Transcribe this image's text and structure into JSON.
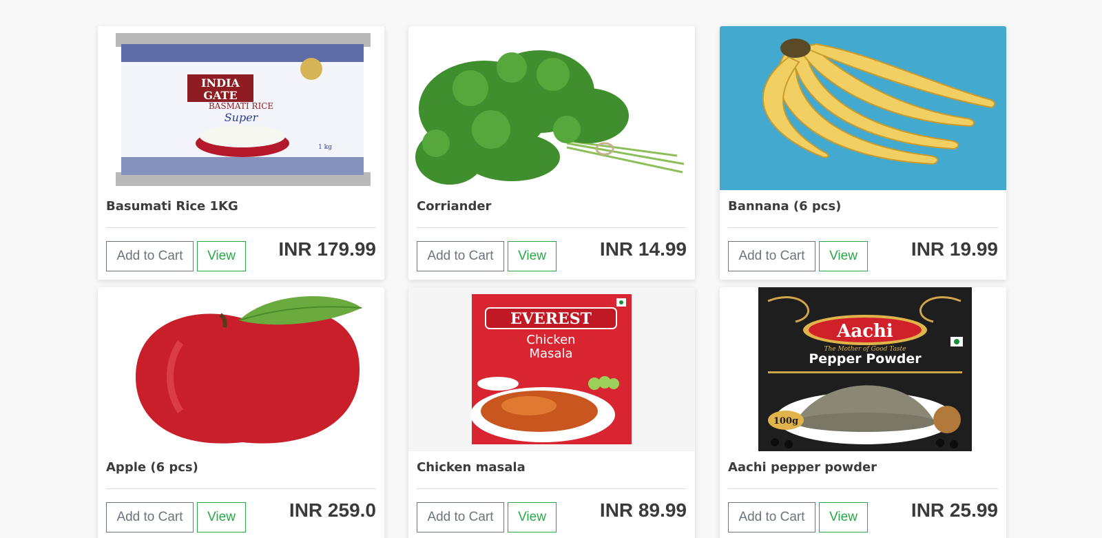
{
  "products": [
    {
      "title": "Basumati Rice 1KG",
      "price": "INR 179.99",
      "add_label": "Add to Cart",
      "view_label": "View",
      "image": {
        "package_line1": "INDIA",
        "package_line2": "GATE",
        "package_line3": "BASMATI RICE",
        "package_line4": "Super",
        "weight": "1 kg"
      }
    },
    {
      "title": "Corriander",
      "price": "INR 14.99",
      "add_label": "Add to Cart",
      "view_label": "View"
    },
    {
      "title": "Bannana (6 pcs)",
      "price": "INR 19.99",
      "add_label": "Add to Cart",
      "view_label": "View"
    },
    {
      "title": "Apple (6 pcs)",
      "price": "INR 259.0",
      "add_label": "Add to Cart",
      "view_label": "View"
    },
    {
      "title": "Chicken masala",
      "price": "INR 89.99",
      "add_label": "Add to Cart",
      "view_label": "View",
      "image": {
        "brand": "EVEREST",
        "line1": "Chicken",
        "line2": "Masala"
      }
    },
    {
      "title": "Aachi pepper powder",
      "price": "INR 25.99",
      "add_label": "Add to Cart",
      "view_label": "View",
      "image": {
        "brand": "Aachi",
        "tagline": "The Mother of Good Taste",
        "product": "Pepper Powder",
        "weight": "100g"
      }
    }
  ],
  "colors": {
    "view_button": "#28a745",
    "cart_button": "#6c757d",
    "page_bg": "#f8f8f8"
  }
}
